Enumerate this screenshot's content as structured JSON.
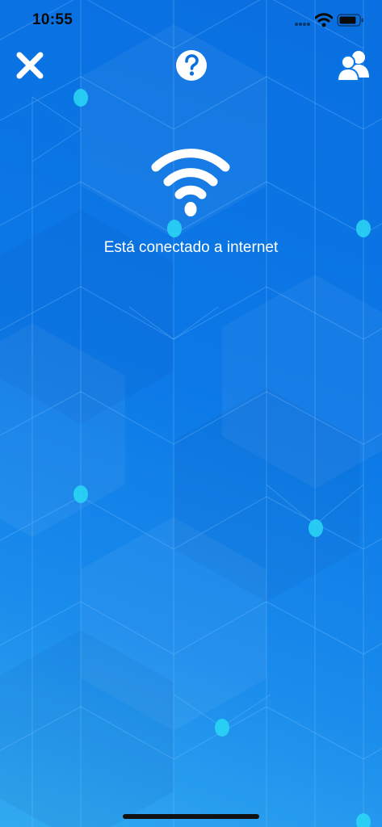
{
  "status_bar": {
    "time": "10:55"
  },
  "toolbar": {
    "close_icon": "close-icon",
    "help_icon": "help-icon",
    "people_icon": "users-icon"
  },
  "connection": {
    "icon": "wifi-icon",
    "message": "Está conectado a internet"
  },
  "colors": {
    "background": "#0b78e6",
    "accent_node": "#2ad8f5",
    "text": "#ffffff"
  }
}
